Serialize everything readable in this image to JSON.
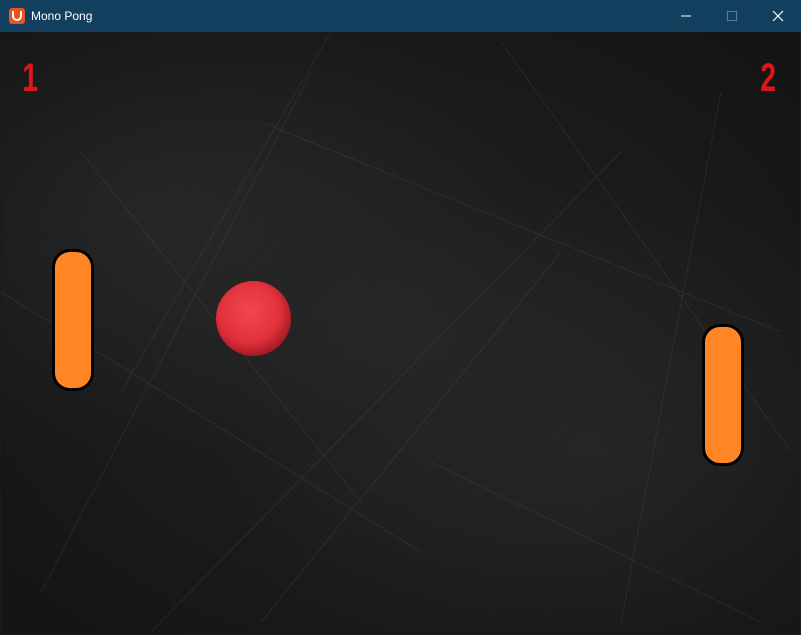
{
  "window": {
    "title": "Mono Pong",
    "controls": {
      "minimize_icon": "minimize-icon",
      "maximize_icon": "maximize-icon",
      "close_icon": "close-icon"
    }
  },
  "game": {
    "score_left": "1",
    "score_right": "2",
    "colors": {
      "paddle": "#ff8525",
      "ball": "#e0303b",
      "score": "#e1141b",
      "background": "#1b1b1b",
      "titlebar": "#133f5f"
    }
  }
}
